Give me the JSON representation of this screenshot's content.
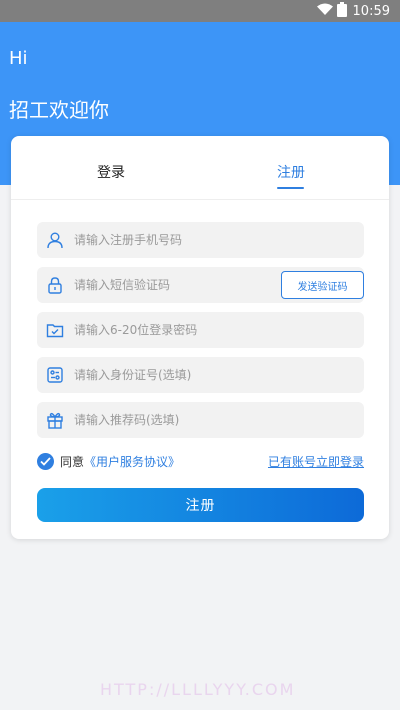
{
  "status_bar": {
    "time": "10:59",
    "wifi_icon": "wifi-icon",
    "battery_icon": "battery-icon"
  },
  "header": {
    "greeting": "Hi",
    "welcome": "招工欢迎你"
  },
  "tabs": {
    "login": "登录",
    "register": "注册",
    "active": "register"
  },
  "form": {
    "phone_placeholder": "请输入注册手机号码",
    "sms_placeholder": "请输入短信验证码",
    "send_code_label": "发送验证码",
    "password_placeholder": "请输入6-20位登录密码",
    "idcard_placeholder": "请输入身份证号(选填)",
    "referral_placeholder": "请输入推荐码(选填)"
  },
  "agreement": {
    "prefix": "同意",
    "link": "《用户服务协议》",
    "checked": true,
    "login_link": "已有账号立即登录"
  },
  "submit_label": "注册",
  "watermark": "HTTP://LLLLYYY.COM",
  "colors": {
    "primary": "#2f7fe0",
    "header_bg": "#3d95f7"
  }
}
